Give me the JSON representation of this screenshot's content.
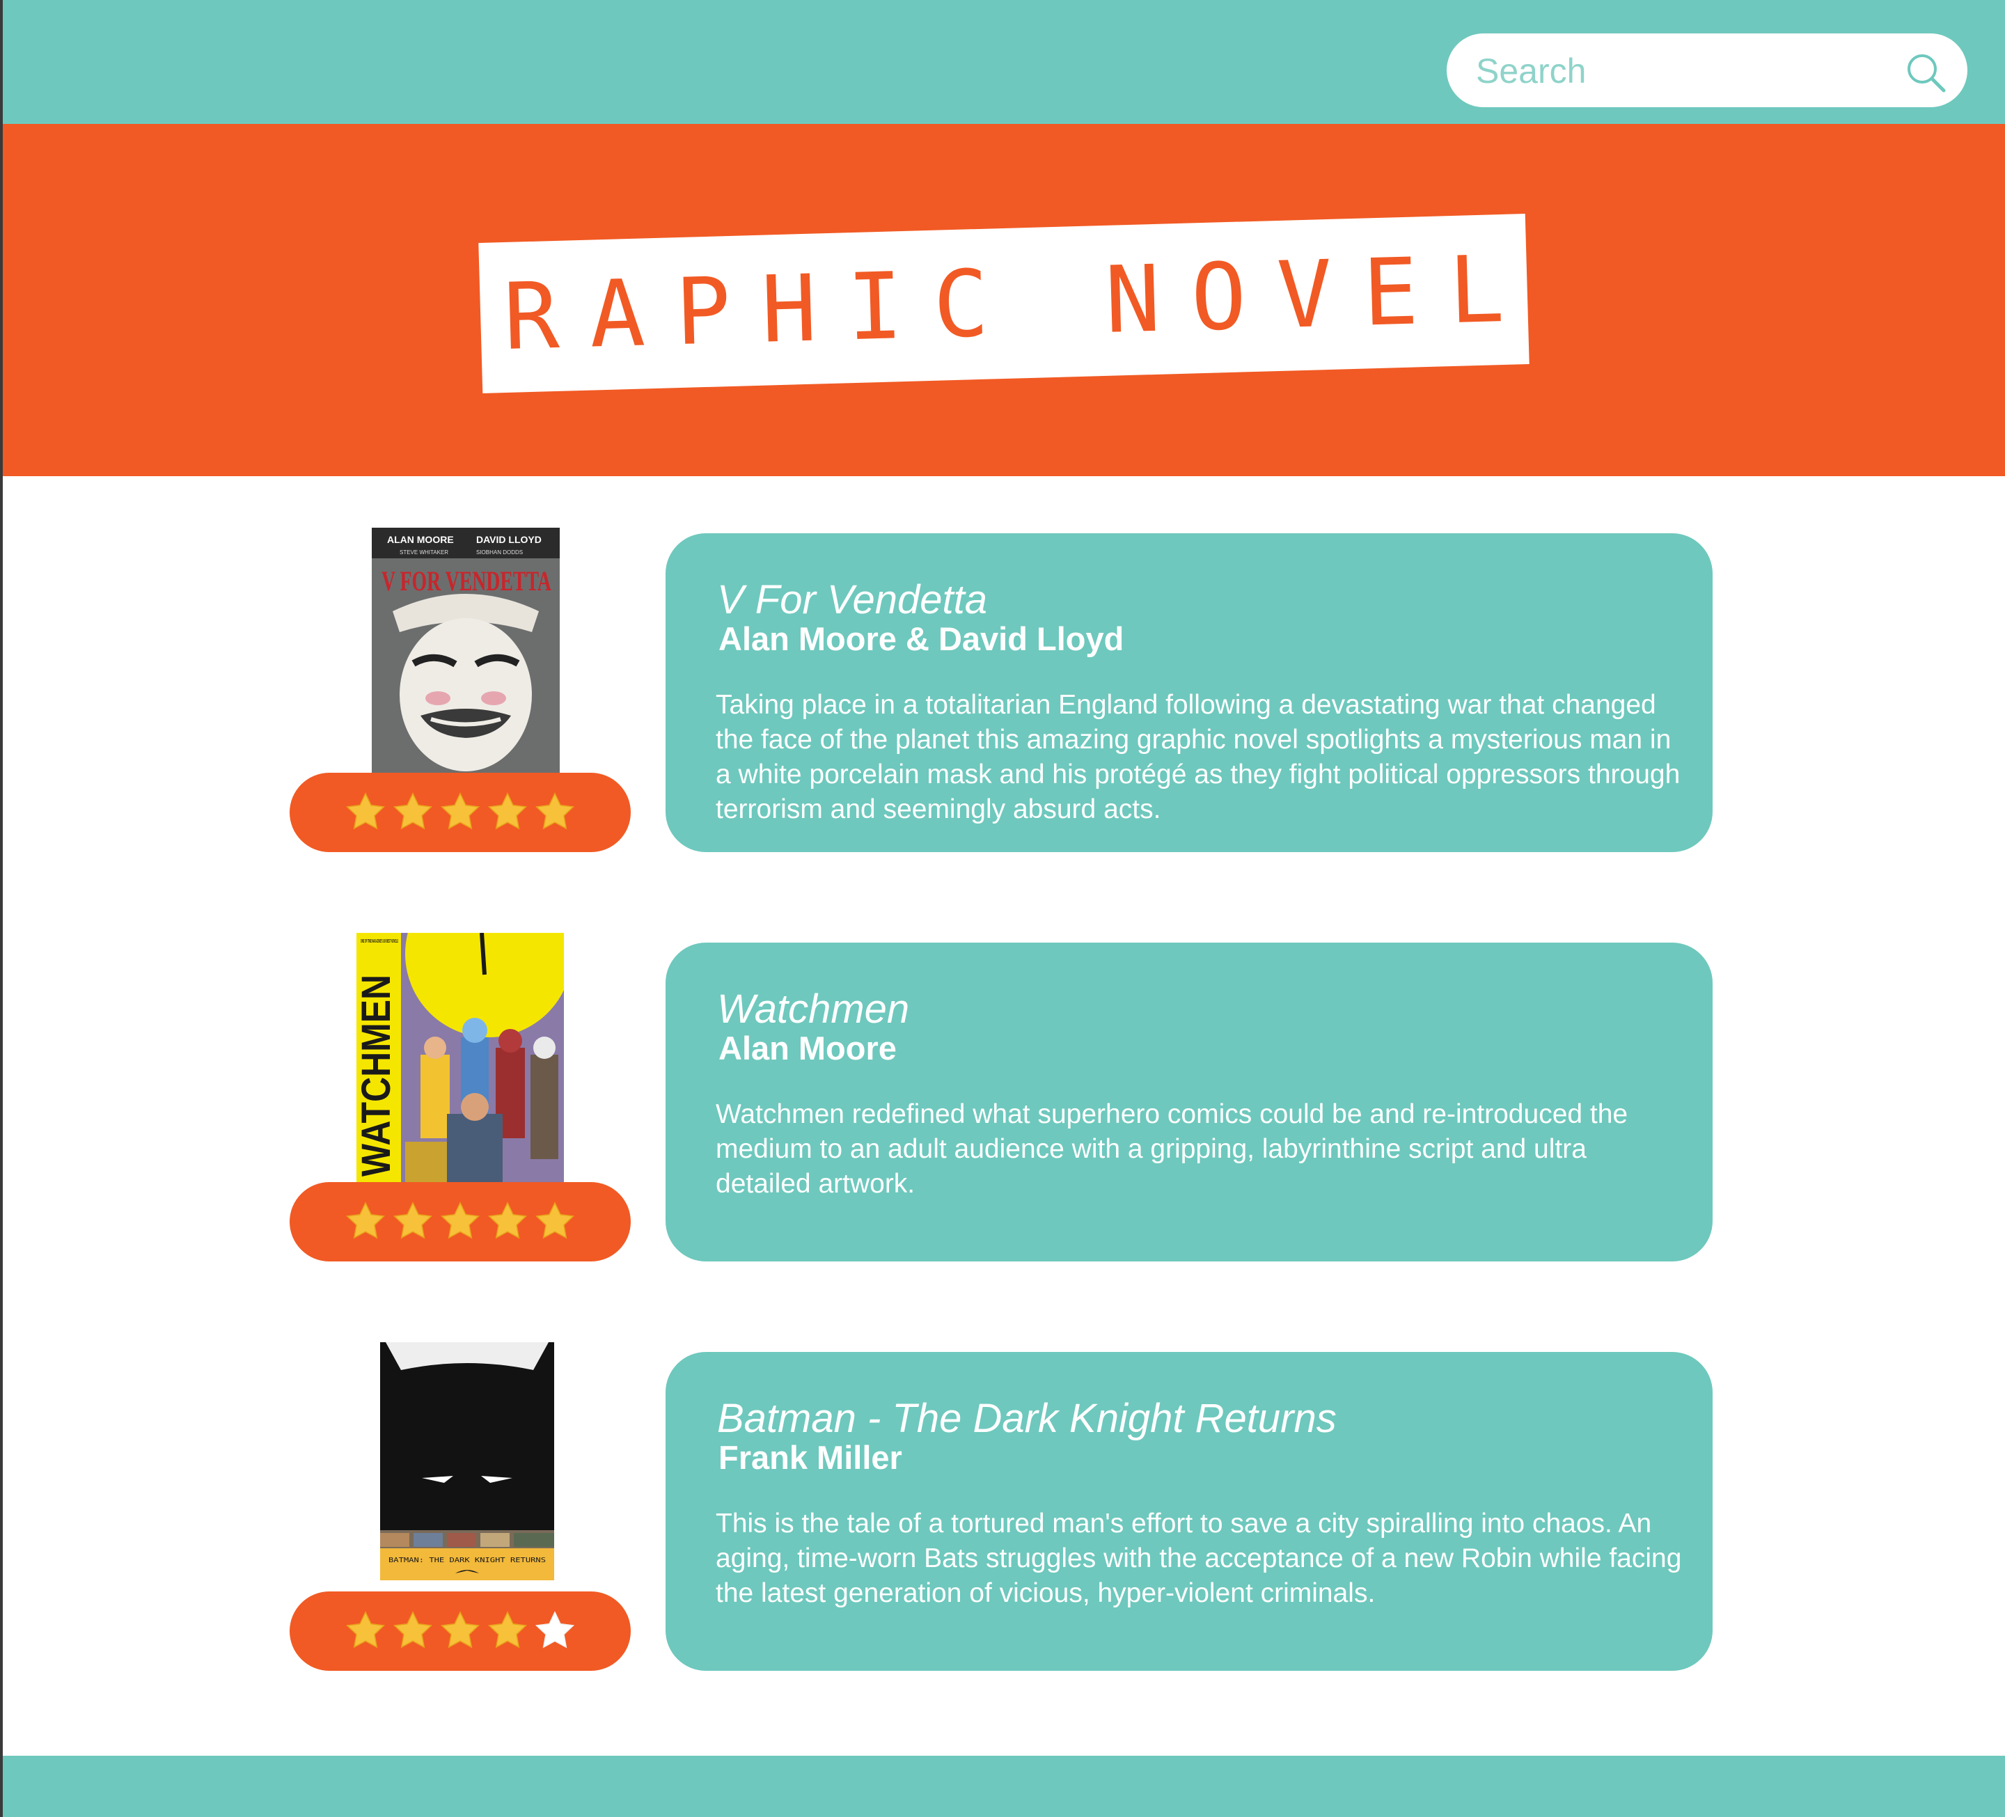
{
  "search": {
    "placeholder": "Search"
  },
  "hero": {
    "title": "Graphic Novels"
  },
  "colors": {
    "teal": "#6ec8bd",
    "orange": "#f15a24",
    "star_gold": "#f7c23a",
    "white": "#ffffff"
  },
  "books": [
    {
      "title": "V For Vendetta",
      "author": "Alan Moore & David Lloyd",
      "description": "Taking place in a totalitarian England following a devastating war that changed the face of the planet this amazing graphic novel spotlights a mysterious man in a white porcelain mask and his protégé as they fight political oppressors through terrorism and seemingly absurd acts.",
      "rating": 5,
      "rating_max": 5,
      "cover_icon": "v-for-vendetta-cover",
      "cover_text": {
        "author1": "ALAN MOORE",
        "author2": "DAVID LLOYD",
        "credit1": "STEVE WHITAKER",
        "credit2": "SIOBHAN DODDS",
        "title": "V FOR VENDETTA"
      }
    },
    {
      "title": "Watchmen",
      "author": "Alan Moore",
      "description": "Watchmen redefined what superhero comics could be and re-introduced the medium to an adult audience with a gripping, labyrinthine script and ultra detailed artwork.",
      "rating": 5,
      "rating_max": 5,
      "cover_icon": "watchmen-cover",
      "cover_text": {
        "tagline": "ONE OF TIME MAGAZINE'S 100 BEST NOVELS",
        "title": "WATCHMEN"
      }
    },
    {
      "title": "Batman - The Dark Knight Returns",
      "author": "Frank Miller",
      "description": "This is the tale of a tortured man's effort to save a city spiralling into chaos. An aging, time-worn Bats struggles with the acceptance of a new Robin while facing the latest generation of vicious, hyper-violent criminals.",
      "rating": 4,
      "rating_max": 5,
      "cover_icon": "dark-knight-returns-cover",
      "cover_text": {
        "title": "BATMAN: THE DARK KNIGHT RETURNS"
      }
    }
  ]
}
